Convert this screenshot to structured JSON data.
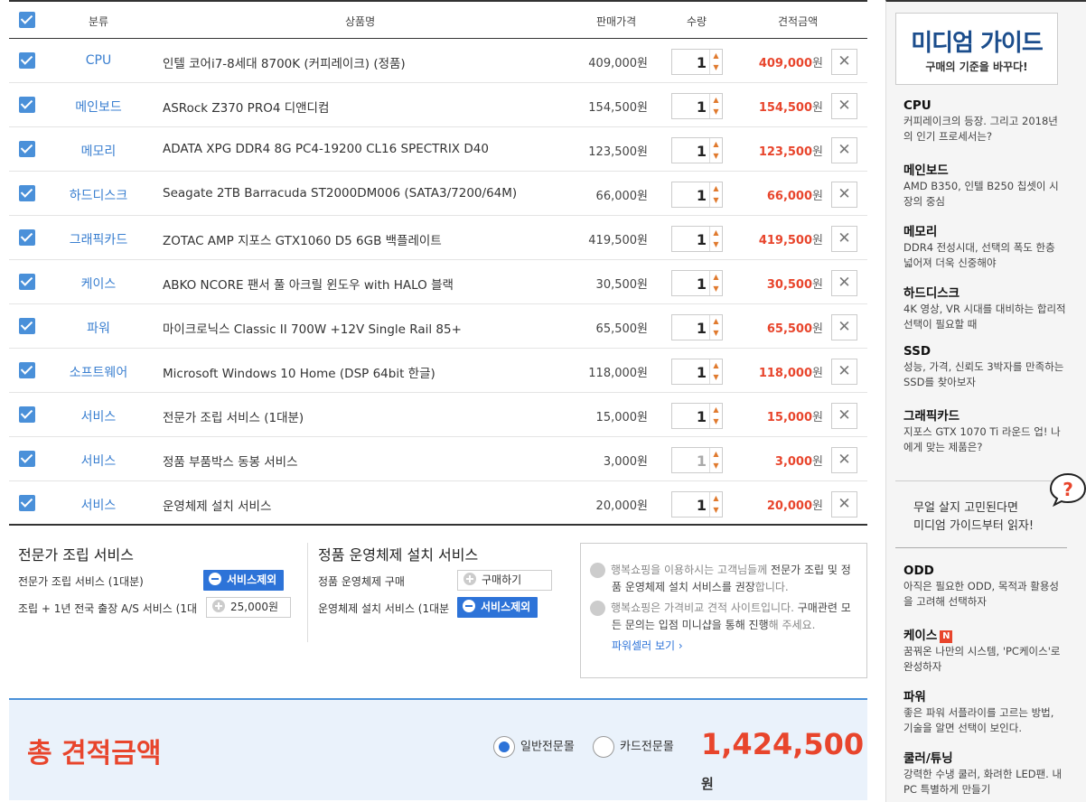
{
  "columns": {
    "category": "분류",
    "product": "상품명",
    "price": "판매가격",
    "qty": "수량",
    "estimate": "견적금액"
  },
  "currency_suffix": "원",
  "rows": [
    {
      "category": "CPU",
      "name": "인텔 코어i7-8세대 8700K (커피레이크) (정품)",
      "price": "409,000원",
      "qty": "1",
      "qty_disabled": false,
      "total": "409,000"
    },
    {
      "category": "메인보드",
      "name": "ASRock Z370 PRO4 디앤디컴",
      "price": "154,500원",
      "qty": "1",
      "qty_disabled": false,
      "total": "154,500"
    },
    {
      "category": "메모리",
      "name": "ADATA XPG DDR4 8G PC4-19200 CL16 SPECTRIX D40",
      "price": "123,500원",
      "qty": "1",
      "qty_disabled": false,
      "total": "123,500"
    },
    {
      "category": "하드디스크",
      "name": "Seagate 2TB Barracuda ST2000DM006 (SATA3/7200/64M)",
      "price": "66,000원",
      "qty": "1",
      "qty_disabled": false,
      "total": "66,000"
    },
    {
      "category": "그래픽카드",
      "name": "ZOTAC AMP 지포스 GTX1060 D5 6GB 백플레이트",
      "price": "419,500원",
      "qty": "1",
      "qty_disabled": false,
      "total": "419,500"
    },
    {
      "category": "케이스",
      "name": "ABKO NCORE 팬서 풀 아크릴 윈도우 with HALO 블랙",
      "price": "30,500원",
      "qty": "1",
      "qty_disabled": false,
      "total": "30,500"
    },
    {
      "category": "파워",
      "name": "마이크로닉스 Classic II 700W +12V Single Rail 85+",
      "price": "65,500원",
      "qty": "1",
      "qty_disabled": false,
      "total": "65,500"
    },
    {
      "category": "소프트웨어",
      "name": "Microsoft Windows 10 Home (DSP 64bit 한글)",
      "price": "118,000원",
      "qty": "1",
      "qty_disabled": false,
      "total": "118,000"
    },
    {
      "category": "서비스",
      "name": "전문가 조립 서비스 (1대분)",
      "price": "15,000원",
      "qty": "1",
      "qty_disabled": false,
      "total": "15,000"
    },
    {
      "category": "서비스",
      "name": "정품 부품박스 동봉 서비스",
      "price": "3,000원",
      "qty": "1",
      "qty_disabled": true,
      "total": "3,000"
    },
    {
      "category": "서비스",
      "name": "운영체제 설치 서비스",
      "price": "20,000원",
      "qty": "1",
      "qty_disabled": false,
      "total": "20,000"
    }
  ],
  "assembly": {
    "title": "전문가 조립 서비스",
    "line1": "전문가 조립 서비스 (1대분)",
    "line1_button": "서비스제외",
    "line2": "조립 + 1년 전국 출장 A/S 서비스 (1대",
    "line2_button": "25,000원"
  },
  "os_install": {
    "title": "정품 운영체제 설치 서비스",
    "line1": "정품 운영체제 구매",
    "line1_button": "구매하기",
    "line2": "운영체제 설치 서비스 (1대분",
    "line2_button": "서비스제외"
  },
  "info": {
    "p1a": "행복쇼핑을 이용하시는 고객님들께 ",
    "p1b": "전문가 조립 및 정품 운영체제 설치 서비스를 권장",
    "p1c": "합니다.",
    "p2a": "행복쇼핑은 가격비교 견적 사이트입니다. ",
    "p2b": "구매관련 모든 문의는 입점 미니샵을 통해 진행",
    "p2c": "해 주세요.",
    "link": "파워셀러 보기 ›"
  },
  "total": {
    "label": "총 견적금액",
    "radio1": "일반전문몰",
    "radio2": "카드전문몰",
    "amount": "1,424,500",
    "suffix": "원"
  },
  "sidebar": {
    "logo_title": "미디엄 가이드",
    "logo_sub": "구매의 기준을 바꾸다!",
    "guides": [
      {
        "h": "CPU",
        "d": "커피레이크의 등장. 그리고 2018년의 인기 프로세서는?"
      },
      {
        "h": "메인보드",
        "d": "AMD B350, 인텔 B250 칩셋이 시장의 중심"
      },
      {
        "h": "메모리",
        "d": "DDR4 전성시대, 선택의 폭도 한층 넓어져 더욱 신중해야"
      },
      {
        "h": "하드디스크",
        "d": "4K 영상, VR 시대를 대비하는 합리적 선택이 필요할 때"
      },
      {
        "h": "SSD",
        "d": "성능, 가격, 신뢰도 3박자를 만족하는 SSD를 찾아보자"
      },
      {
        "h": "그래픽카드",
        "d": "지포스 GTX 1070 Ti 라운드 업! 나에게 맞는 제품은?"
      }
    ],
    "mid_line1": "무얼 살지 고민된다면",
    "mid_line2": "미디엄 가이드부터 읽자!",
    "guides2": [
      {
        "h": "ODD",
        "d": "아직은 필요한 ODD, 목적과 활용성을 고려해 선택하자"
      },
      {
        "h": "케이스",
        "d": "꿈꿔온 나만의 시스템, 'PC케이스'로 완성하자",
        "badge": "N"
      },
      {
        "h": "파워",
        "d": "좋은 파워 서플라이를 고르는 방법, 기술을 알면 선택이 보인다."
      },
      {
        "h": "쿨러/튜닝",
        "d": "강력한 수냉 쿨러, 화려한 LED팬. 내 PC 특별하게 만들기"
      }
    ]
  }
}
